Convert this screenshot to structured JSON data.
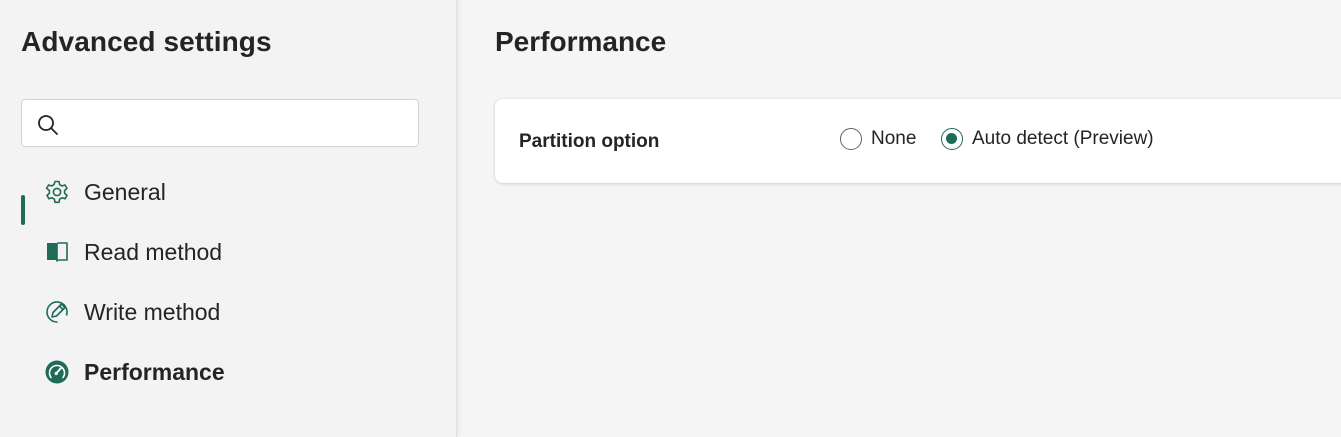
{
  "sidebar": {
    "title": "Advanced settings",
    "search": {
      "value": "",
      "placeholder": ""
    },
    "items": [
      {
        "label": "General",
        "icon": "gear-icon",
        "active": false
      },
      {
        "label": "Read method",
        "icon": "book-icon",
        "active": false
      },
      {
        "label": "Write method",
        "icon": "pen-icon",
        "active": false
      },
      {
        "label": "Performance",
        "icon": "gauge-icon",
        "active": true
      }
    ]
  },
  "main": {
    "title": "Performance",
    "partition": {
      "label": "Partition option",
      "options": [
        {
          "label": "None",
          "selected": false
        },
        {
          "label": "Auto detect (Preview)",
          "selected": true
        }
      ]
    }
  },
  "colors": {
    "accent": "#1f6b57",
    "background": "#f5f5f5",
    "sidebar": "#f3f3f3"
  }
}
